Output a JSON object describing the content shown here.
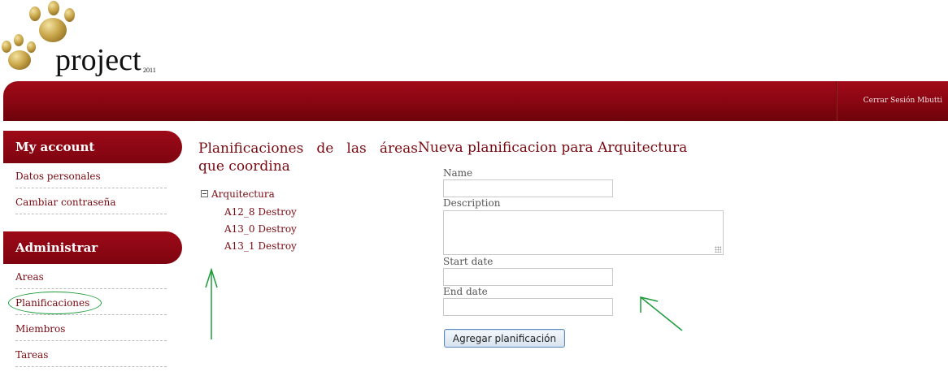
{
  "brand": {
    "name": "project",
    "year": "2011"
  },
  "topbar": {
    "logout_label": "Cerrar Sesión Mbutti"
  },
  "sidebar": {
    "sections": [
      {
        "title": "My account",
        "items": [
          "Datos personales",
          "Cambiar contraseña"
        ]
      },
      {
        "title": "Administrar",
        "items": [
          "Areas",
          "Planificaciones",
          "Miembros",
          "Tareas"
        ]
      }
    ]
  },
  "plans": {
    "title": "Planificaciones de las áreas que coordina",
    "tree": {
      "root": "Arquitectura",
      "children": [
        "A12_8 Destroy",
        "A13_0 Destroy",
        "A13_1 Destroy"
      ]
    }
  },
  "form": {
    "title": "Nueva planificacion para Arquitectura",
    "name_label": "Name",
    "name_value": "",
    "description_label": "Description",
    "description_value": "",
    "start_label": "Start date",
    "start_value": "",
    "end_label": "End date",
    "end_value": "",
    "submit_label": "Agregar planificación"
  },
  "colors": {
    "brand": "#8a0612",
    "text": "#7a0a12",
    "annotation": "#1e9b3a"
  }
}
